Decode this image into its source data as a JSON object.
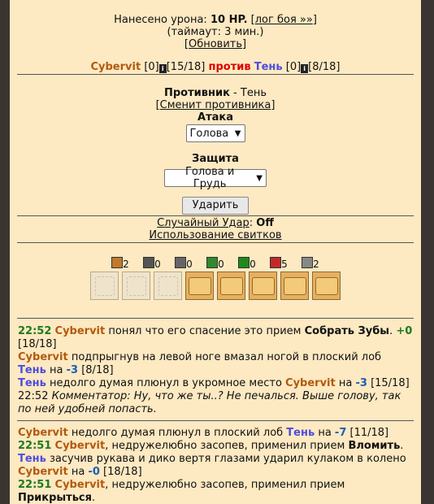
{
  "damage": {
    "prefix": "Нанесено урона: ",
    "amount": "10 HP.",
    "log_link": "лог боя »»"
  },
  "timeout": "(таймаут: 3 мин.)",
  "refresh": "Обновить",
  "fight": {
    "p1": {
      "name": "Cybervit",
      "level": "[0]",
      "hp": "[15/18]"
    },
    "vs": "против",
    "p2": {
      "name": "Тень",
      "level": "[0]",
      "hp": "[8/18]"
    }
  },
  "opponent": {
    "label": "Противник",
    "sep": " - ",
    "name": "Тень",
    "change": "Сменит противника"
  },
  "attack": {
    "label": "Атака",
    "value": "Голова"
  },
  "defense": {
    "label": "Защита",
    "value": "Голова и Грудь"
  },
  "hit_button": "Ударить",
  "random": {
    "label": "Случайный Удар",
    "sep": ": ",
    "value": "Off"
  },
  "scrolls_link": "Использование свитков",
  "belt": [
    {
      "count": "2",
      "color": "#c27a2c",
      "icon": "fist-icon"
    },
    {
      "count": "0",
      "color": "#555",
      "icon": "sword-icon"
    },
    {
      "count": "0",
      "color": "#666",
      "icon": "cross-icon"
    },
    {
      "count": "0",
      "color": "#2f8a2f",
      "icon": "green-orb-icon"
    },
    {
      "count": "0",
      "color": "#1e8a1e",
      "icon": "green-shield-icon"
    },
    {
      "count": "5",
      "color": "#c22a2a",
      "icon": "red-orb-icon"
    },
    {
      "count": "2",
      "color": "#888",
      "icon": "gray-orb-icon"
    }
  ],
  "log": {
    "e1": {
      "time": "22:52",
      "actor": "Cybervit",
      "text": " понял что его спасение это прием ",
      "skill": "Собрать Зубы",
      "dot": ".",
      "gain": "+0",
      "hp": "[18/18]"
    },
    "e2": {
      "actor": "Cybervit",
      "text": " подпрыгнув на левой ноге вмазал ногой в плоский лоб ",
      "target": "Тень",
      "on": " на ",
      "dmg": "-3",
      "hp": "[8/18]"
    },
    "e3": {
      "actor": "Тень",
      "text": " недолго думая плюнул в укромное место ",
      "target": "Cybervit",
      "on": " на ",
      "dmg": "-3",
      "hp": "[15/18]"
    },
    "e4": {
      "time": "22:52",
      "label": "Комментатор:",
      "text": "Ну, что же ты..? Не печалься. Выше голову, так по ней удобней попасть."
    },
    "e5": {
      "actor": "Cybervit",
      "text": " недолго думая плюнул в плоский лоб ",
      "target": "Тень",
      "on": " на ",
      "dmg": "-7",
      "hp": "[11/18]"
    },
    "e6": {
      "time": "22:51",
      "actor": "Cybervit",
      "text": ", недружелюбно засопев, применил прием ",
      "skill": "Вломить",
      "end": "."
    },
    "e7": {
      "actor": "Тень",
      "text": " засучив рукава и дико вертя глазами ударил кулаком в колено ",
      "target": "Cybervit",
      "on": " на ",
      "dmg": "-0",
      "hp": "[18/18]"
    },
    "e8": {
      "time": "22:51",
      "actor": "Cybervit",
      "text": ", недружелюбно засопев, применил прием ",
      "skill": "Прикрыться",
      "end": "."
    }
  },
  "colors": {
    "panel_bg": "#fde9c2",
    "player1": "#b25a0e",
    "player2": "#4d4ddd",
    "vs": "#dd0000",
    "time": "#1e7a1e"
  }
}
